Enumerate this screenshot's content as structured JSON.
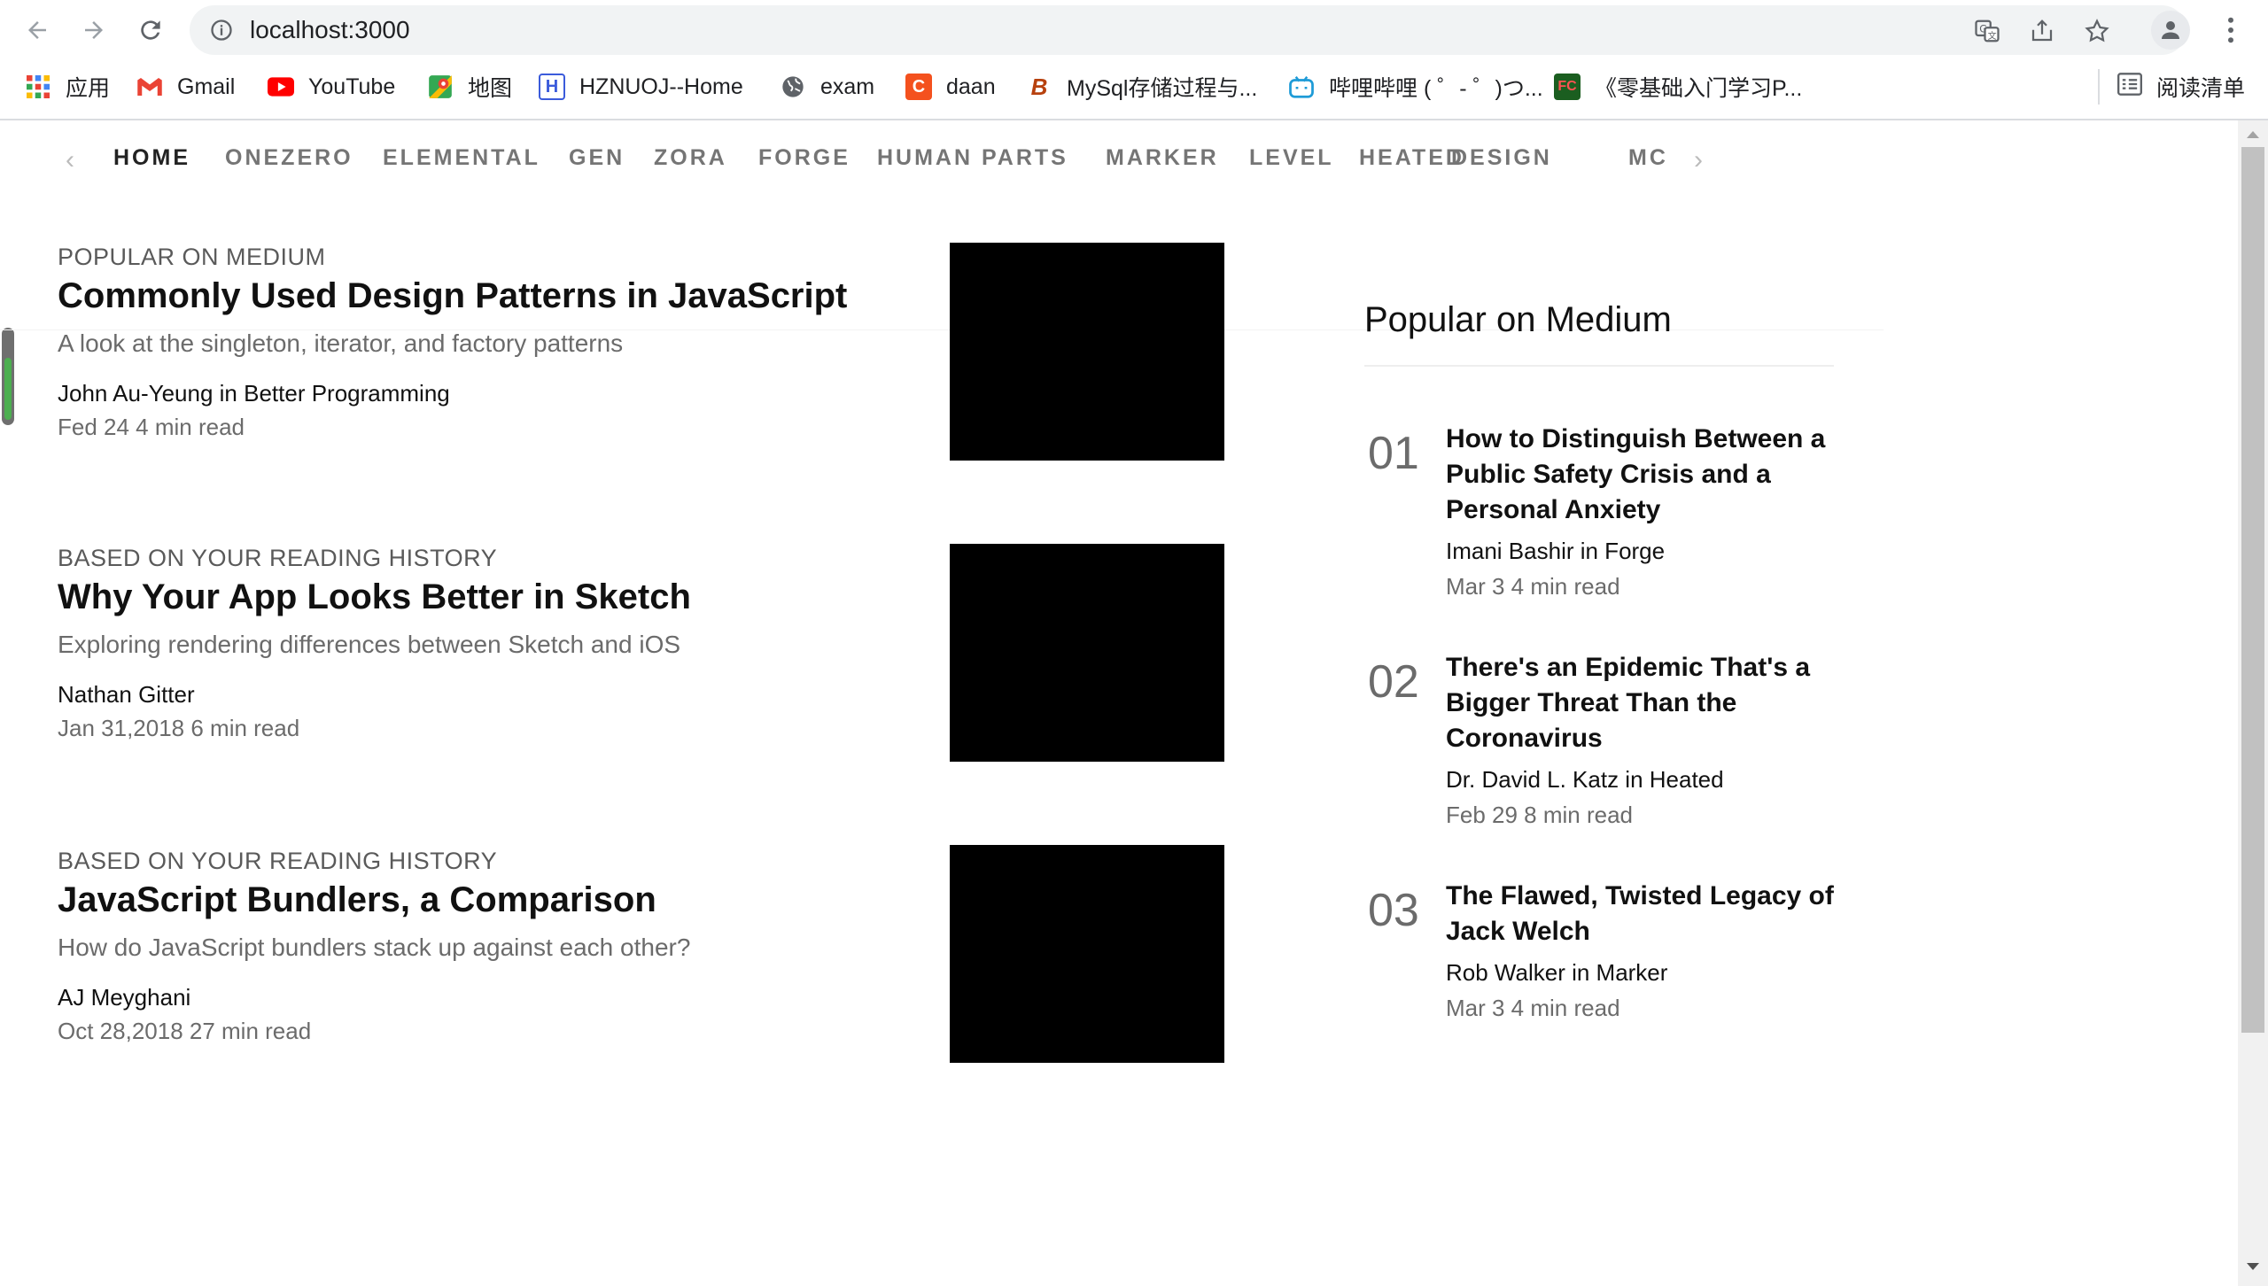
{
  "browser": {
    "url": "localhost:3000",
    "bookmarks": [
      {
        "label": "应用",
        "icon": "apps-grid-icon"
      },
      {
        "label": "Gmail",
        "icon": "gmail-icon"
      },
      {
        "label": "YouTube",
        "icon": "youtube-icon"
      },
      {
        "label": "地图",
        "icon": "maps-icon"
      },
      {
        "label": "HZNUOJ--Home",
        "icon": "hznuoj-icon"
      },
      {
        "label": "exam",
        "icon": "globe-icon"
      },
      {
        "label": "daan",
        "icon": "daan-icon"
      },
      {
        "label": "MySql存储过程与...",
        "icon": "mysql-bookmark-icon"
      },
      {
        "label": "哔哩哔哩 ( ゜- ゜)つ...",
        "icon": "bilibili-icon"
      },
      {
        "label": "《零基础入门学习P...",
        "icon": "fc-icon"
      }
    ],
    "reading_list": "阅读清单"
  },
  "topnav": {
    "links": [
      "HOME",
      "ONEZERO",
      "ELEMENTAL",
      "GEN",
      "ZORA",
      "FORGE",
      "HUMAN PARTS",
      "MARKER",
      "LEVEL",
      "HEATED",
      "DESIGN",
      "MC"
    ]
  },
  "articles": [
    {
      "kicker": "POPULAR ON MEDIUM",
      "title": "Commonly Used Design Patterns in JavaScript",
      "subtitle": "A look at the singleton, iterator, and factory patterns",
      "author": "John Au-Yeung in Better Programming",
      "meta": "Fed 24 4 min read"
    },
    {
      "kicker": "BASED ON YOUR READING HISTORY",
      "title": "Why Your App Looks Better in Sketch",
      "subtitle": "Exploring rendering differences between Sketch and iOS",
      "author": "Nathan Gitter",
      "meta": "Jan 31,2018 6 min read"
    },
    {
      "kicker": "BASED ON YOUR READING HISTORY",
      "title": "JavaScript Bundlers, a Comparison",
      "subtitle": "How do JavaScript bundlers stack up against each other?",
      "author": "AJ Meyghani",
      "meta": "Oct 28,2018 27 min read"
    }
  ],
  "sidebar": {
    "heading": "Popular on Medium",
    "items": [
      {
        "num": "01",
        "title": "How to Distinguish Between a Public Safety Crisis and a Personal Anxiety",
        "author": "Imani Bashir in Forge",
        "meta": "Mar 3 4 min read"
      },
      {
        "num": "02",
        "title": "There's an Epidemic That's a Bigger Threat Than the Coronavirus",
        "author": "Dr. David L. Katz in Heated",
        "meta": "Feb 29 8 min read"
      },
      {
        "num": "03",
        "title": "The Flawed, Twisted Legacy of Jack Welch",
        "author": "Rob Walker in Marker",
        "meta": "Mar 3 4 min read"
      }
    ]
  }
}
